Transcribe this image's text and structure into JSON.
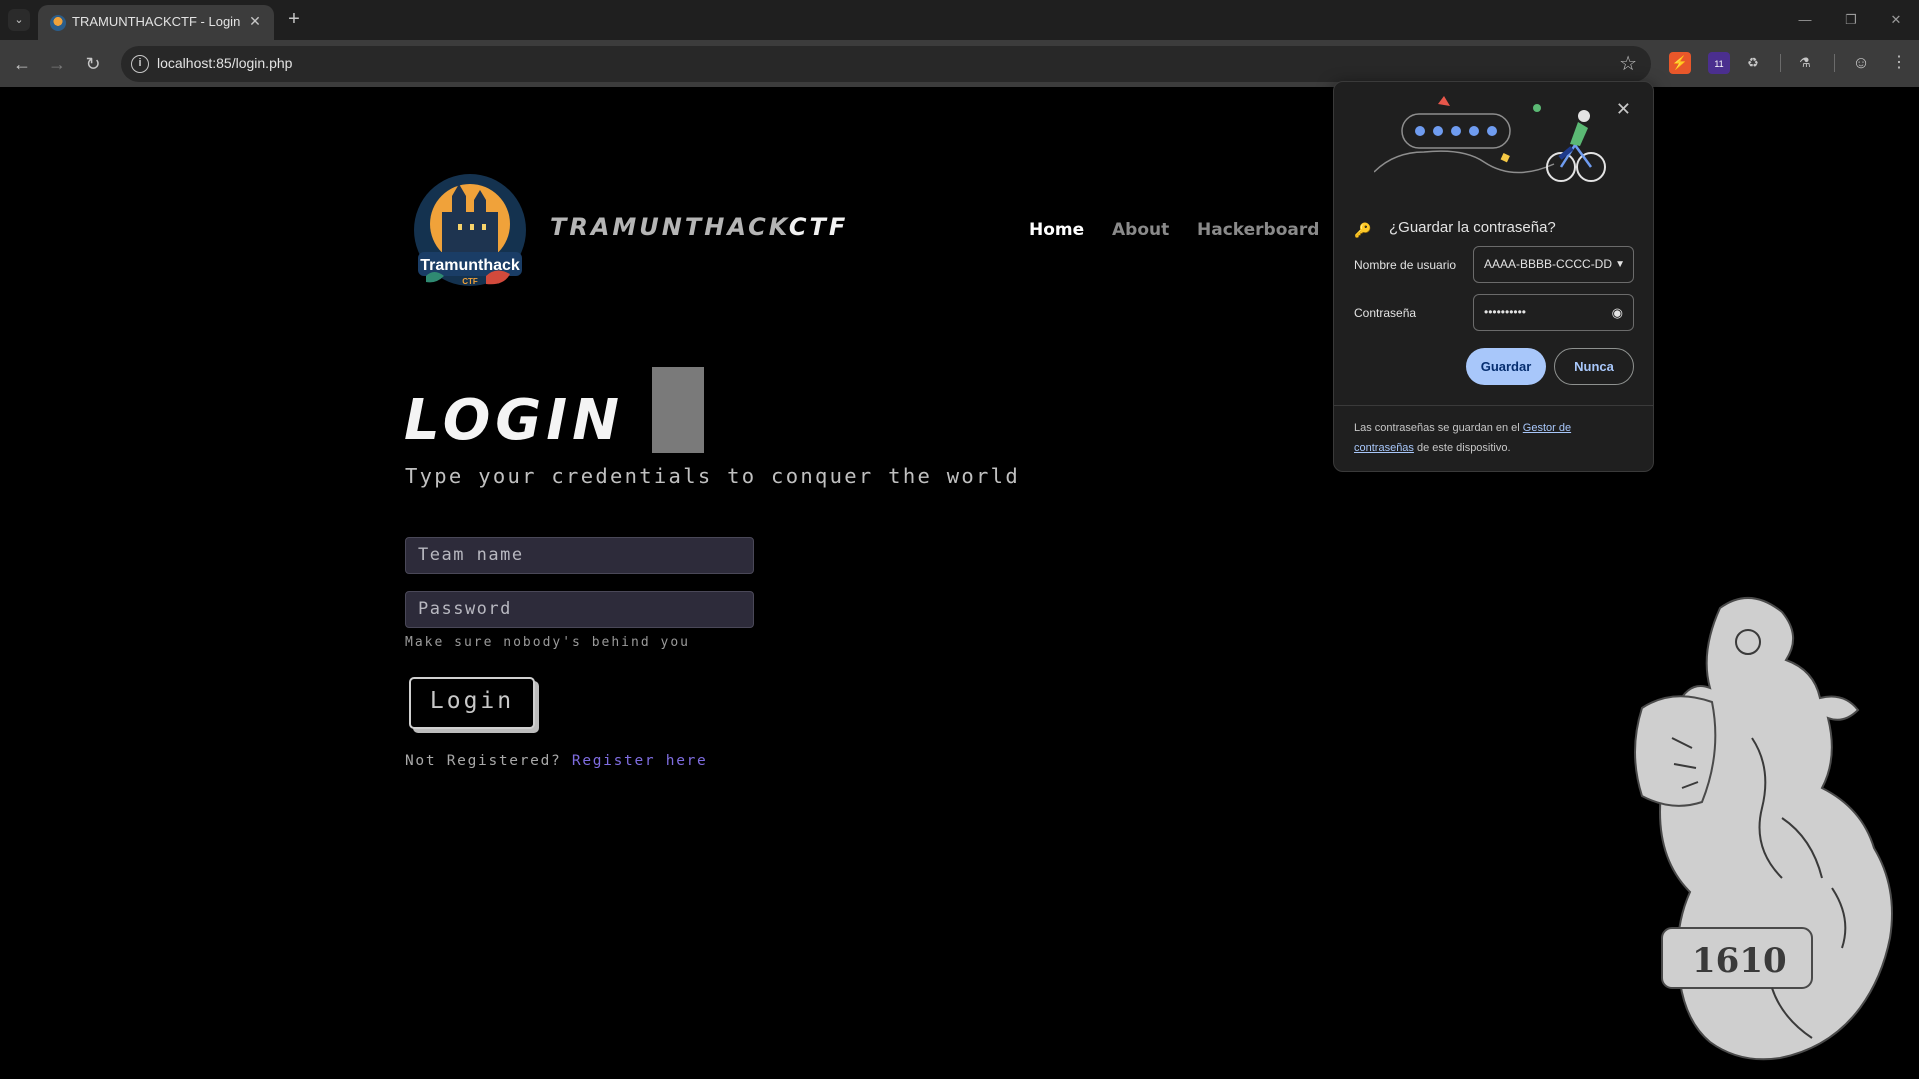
{
  "browser": {
    "tab_title": "TRAMUNTHACKCTF - Login",
    "url": "localhost:85/login.php",
    "extension_badge": "11"
  },
  "site": {
    "logo_text": "Tramunthack",
    "logo_sub": "CTF",
    "brand_main": "TRAMUNTHACK",
    "brand_ctf": "CTF",
    "nav": [
      "Home",
      "About",
      "Hackerboard"
    ],
    "nav_active": "Home"
  },
  "login": {
    "heading": "LOGIN",
    "subtitle": "Type your credentials to conquer the world",
    "team_placeholder": "Team name",
    "password_placeholder": "Password",
    "hint": "Make sure nobody's behind you",
    "button": "Login",
    "not_registered": "Not Registered?",
    "register_link": "Register here"
  },
  "popup": {
    "title": "¿Guardar la contraseña?",
    "username_label": "Nombre de usuario",
    "username_value": "AAAA-BBBB-CCCC-DD",
    "password_label": "Contraseña",
    "password_value": "••••••••••",
    "save": "Guardar",
    "never": "Nunca",
    "footer_pre": "Las contraseñas se guardan en el ",
    "footer_link": "Gestor de contraseñas",
    "footer_post": " de este dispositivo."
  },
  "colors": {
    "page_bg": "#000000",
    "input_bg": "#2d2b3a",
    "link": "#7f6de0",
    "popup_primary": "#a8c7fa"
  }
}
